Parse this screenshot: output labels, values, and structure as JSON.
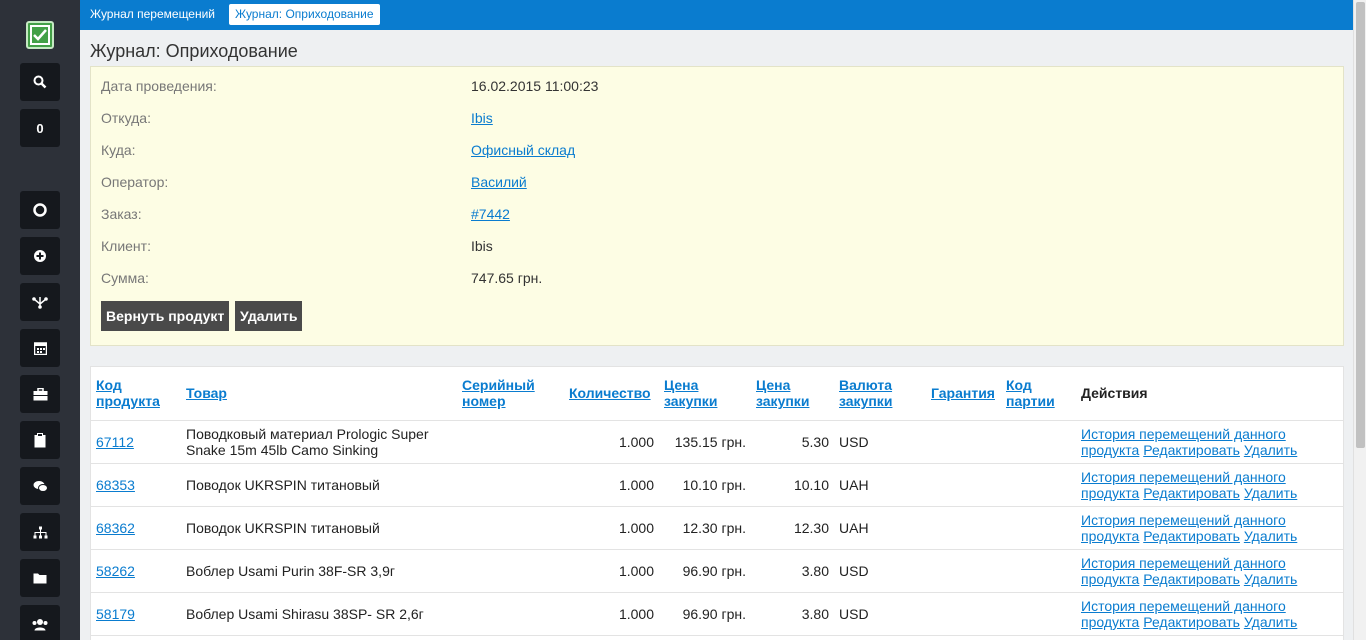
{
  "nav": {
    "buttons": [
      {
        "name": "search-button",
        "icon": "search-icon",
        "label": ""
      },
      {
        "name": "cart-counter-button",
        "icon": "",
        "label": "0"
      },
      {
        "name": "support-button",
        "icon": "lifebuoy-icon",
        "label": ""
      },
      {
        "name": "add-button",
        "icon": "plus-circle-icon",
        "label": ""
      },
      {
        "name": "transfer-button",
        "icon": "fork-icon",
        "label": ""
      },
      {
        "name": "calendar-button",
        "icon": "calendar-icon",
        "label": ""
      },
      {
        "name": "briefcase-button",
        "icon": "briefcase-icon",
        "label": ""
      },
      {
        "name": "clipboard-button",
        "icon": "clipboard-icon",
        "label": ""
      },
      {
        "name": "chat-button",
        "icon": "chat-icon",
        "label": ""
      },
      {
        "name": "structure-button",
        "icon": "sitemap-icon",
        "label": ""
      },
      {
        "name": "folder-button",
        "icon": "folder-icon",
        "label": ""
      },
      {
        "name": "users-button",
        "icon": "users-icon",
        "label": ""
      }
    ]
  },
  "breadcrumbs": [
    "Журнал перемещений",
    "Журнал: Оприходование"
  ],
  "page_title": "Журнал: Оприходование",
  "info": {
    "date_label": "Дата проведения:",
    "date_value": "16.02.2015 11:00:23",
    "from_label": "Откуда:",
    "from_value": "Ibis",
    "to_label": "Куда:",
    "to_value": "Офисный склад",
    "operator_label": "Оператор:",
    "operator_value": "Василий",
    "order_label": "Заказ:",
    "order_value": "#7442",
    "client_label": "Клиент:",
    "client_value": "Ibis",
    "sum_label": "Сумма:",
    "sum_value": "747.65 грн."
  },
  "actions": {
    "return_label": "Вернуть продукт",
    "delete_label": "Удалить"
  },
  "table": {
    "headers": {
      "code": "Код продукта",
      "product": "Товар",
      "serial": "Серийный номер",
      "qty": "Количество",
      "price1": "Цена закупки",
      "price2": "Цена закупки",
      "currency": "Валюта закупки",
      "warranty": "Гарантия",
      "batch": "Код партии",
      "actions": "Действия"
    },
    "row_actions": {
      "history": "История перемещений данного продукта",
      "edit": "Редактировать",
      "delete": "Удалить"
    },
    "rows": [
      {
        "code": "67112",
        "product": "Поводковый материал Prologic Super Snake 15m 45lb Camo Sinking",
        "serial": "",
        "qty": "1.000",
        "price_uah": "135.15 грн.",
        "price": "5.30",
        "currency": "USD",
        "warranty": "",
        "batch": ""
      },
      {
        "code": "68353",
        "product": "Поводок UKRSPIN титановый",
        "serial": "",
        "qty": "1.000",
        "price_uah": "10.10 грн.",
        "price": "10.10",
        "currency": "UAH",
        "warranty": "",
        "batch": ""
      },
      {
        "code": "68362",
        "product": "Поводок UKRSPIN титановый",
        "serial": "",
        "qty": "1.000",
        "price_uah": "12.30 грн.",
        "price": "12.30",
        "currency": "UAH",
        "warranty": "",
        "batch": ""
      },
      {
        "code": "58262",
        "product": "Воблер Usami Purin 38F-SR 3,9г",
        "serial": "",
        "qty": "1.000",
        "price_uah": "96.90 грн.",
        "price": "3.80",
        "currency": "USD",
        "warranty": "",
        "batch": ""
      },
      {
        "code": "58179",
        "product": "Воблер Usami Shirasu 38SP- SR 2,6г",
        "serial": "",
        "qty": "1.000",
        "price_uah": "96.90 грн.",
        "price": "3.80",
        "currency": "USD",
        "warranty": "",
        "batch": ""
      }
    ]
  }
}
